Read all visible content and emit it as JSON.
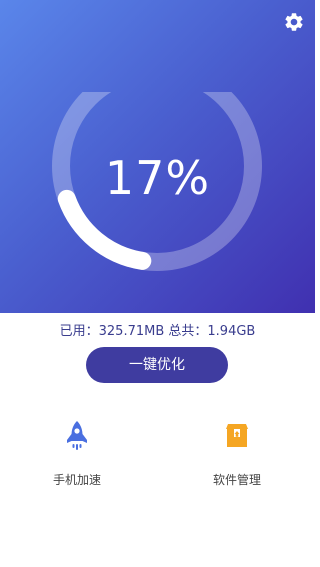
{
  "header": {
    "settings_icon": "gear-icon"
  },
  "memory": {
    "percent_label": "17%",
    "usage_fraction": 0.17,
    "usage_text": "已用：325.71MB 总共：1.94GB"
  },
  "actions": {
    "optimize_label": "一键优化"
  },
  "tools": [
    {
      "label": "手机加速",
      "icon": "rocket-icon"
    },
    {
      "label": "软件管理",
      "icon": "package-icon"
    }
  ],
  "colors": {
    "gradient_start": "#5a86ea",
    "gradient_end": "#4030b0",
    "button": "#3f3ca0",
    "usage_text": "#3a3d8e",
    "rocket": "#4a6fe0",
    "package": "#f5a623"
  }
}
